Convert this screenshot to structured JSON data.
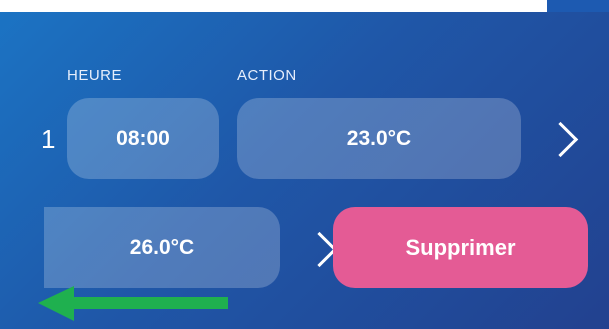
{
  "header": {
    "time_label": "HEURE",
    "action_label": "ACTION"
  },
  "rows": [
    {
      "index": "1",
      "time": "08:00",
      "action": "23.0°C"
    },
    {
      "action": "26.0°C",
      "delete_label": "Supprimer"
    }
  ],
  "icons": {
    "row1_chevron": "chevron-right-icon",
    "row2_chevron": "chevron-right-icon",
    "swipe_arrow": "arrow-left-icon"
  },
  "colors": {
    "background_start": "#1b74c4",
    "background_end": "#22418f",
    "delete": "#e45b95",
    "swipe_arrow": "#1fb04f"
  }
}
